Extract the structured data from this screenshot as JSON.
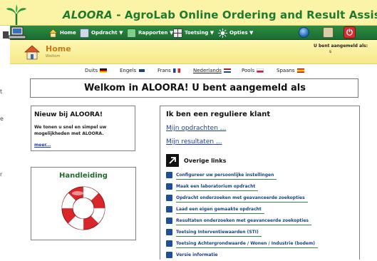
{
  "app": {
    "brand": "ALOORA",
    "title_rest": " - AgroLab Online Ordering and Result Assistent"
  },
  "nav": {
    "items": [
      {
        "label": "Home",
        "icon": "home-icon",
        "color": "#f4d24a"
      },
      {
        "label": "Opdracht ▼",
        "icon": "order-icon",
        "color": "#cfd8e6"
      },
      {
        "label": "Rapporten ▼",
        "icon": "report-icon",
        "color": "#7dcf8a"
      },
      {
        "label": "Toetsing ▼",
        "icon": "grid-icon",
        "color": "#e8e8e8"
      },
      {
        "label": "Opties ▼",
        "icon": "options-icon",
        "color": "#f2f2f2"
      }
    ],
    "right_icons": [
      "globe-icon",
      "tools-icon",
      "power-icon"
    ]
  },
  "home": {
    "title": "Home",
    "subtitle": "Welkom",
    "logged_in": "U bent aangemeld als:",
    "logged_in_value": "s"
  },
  "left_edge": [
    "t",
    "e",
    "r"
  ],
  "languages": [
    {
      "label": "Duits",
      "flag": "de",
      "active": false
    },
    {
      "label": "Engels",
      "flag": "gb",
      "active": false
    },
    {
      "label": "Frans",
      "flag": "fr",
      "active": false
    },
    {
      "label": "Nederlands",
      "flag": "nl",
      "active": true
    },
    {
      "label": "Pools",
      "flag": "pl",
      "active": false
    },
    {
      "label": "Spaans",
      "flag": "es",
      "active": false
    }
  ],
  "welcome": "Welkom in ALOORA! U bent aangemeld als",
  "new_panel": {
    "title": "Nieuw bij ALOORA!",
    "text": "We tonen u snel en simpel uw mogelijkheden met ALOORA.",
    "more": "meer..."
  },
  "manual": {
    "title": "Handleiding"
  },
  "regular": {
    "title": "Ik ben een reguliere klant",
    "link1": "Mijn opdrachten ...",
    "link2": "Mijn resultaten ...",
    "other_title": "Overige links",
    "links": [
      "Configureer uw persoonlijke instellingen",
      "Maak een laboratorium opdracht",
      "Opdracht onderzoeken met geavanceerde zoekopties",
      "Laad een eigen gemaakte opdracht",
      "Resultaten onderzoeken met geavanceerde zoekopties",
      "Toetsing Interventiewaarden (STI)",
      "Toetsing Achtergrondwaarde / Wonen / Industrie (bodem)",
      "Versie informatie"
    ]
  },
  "colors": {
    "title_green": "#1f7a2e",
    "nav_green": "#1b6d30",
    "header_yellow": "#fbf3a6",
    "link_blue": "#1d3fa6",
    "home_orange": "#c47a16"
  }
}
